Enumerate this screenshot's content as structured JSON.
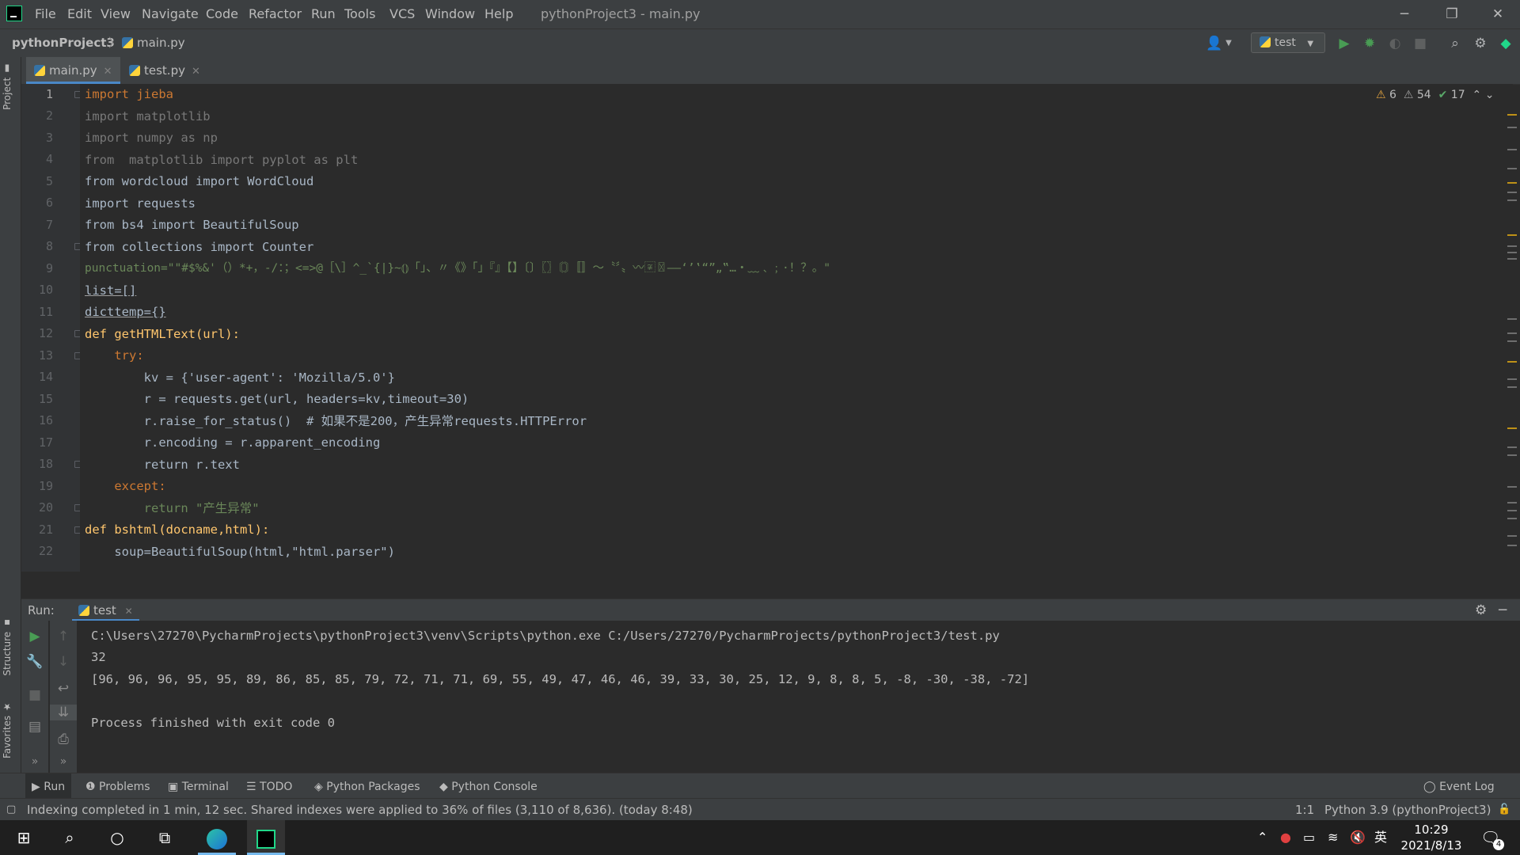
{
  "window": {
    "title": "pythonProject3 - main.py",
    "menu": [
      "File",
      "Edit",
      "View",
      "Navigate",
      "Code",
      "Refactor",
      "Run",
      "Tools",
      "VCS",
      "Window",
      "Help"
    ],
    "controls": {
      "minimize": "─",
      "restore": "❐",
      "close": "✕"
    }
  },
  "navbar": {
    "project": "pythonProject3",
    "file": "main.py",
    "run_config": "test"
  },
  "sidebar": {
    "project_label": "Project",
    "structure_label": "Structure",
    "favorites_label": "Favorites"
  },
  "tabs": [
    {
      "label": "main.py",
      "active": true
    },
    {
      "label": "test.py",
      "active": false
    }
  ],
  "inspections": {
    "errors": "6",
    "warnings": "54",
    "ok": "17"
  },
  "editor": {
    "line_numbers": [
      "1",
      "2",
      "3",
      "4",
      "5",
      "6",
      "7",
      "8",
      "9",
      "10",
      "11",
      "12",
      "13",
      "14",
      "15",
      "16",
      "17",
      "18",
      "19",
      "20",
      "21",
      "22"
    ],
    "lines": [
      "import jieba",
      "import matplotlib",
      "import numpy as np",
      "from  matplotlib import pyplot as plt",
      "from wordcloud import WordCloud",
      "import requests",
      "from bs4 import BeautifulSoup",
      "from collections import Counter",
      "punctuation=\"\"#$%&'（）*+，-/：；<=>@［\\］^_`{|}~⦅⦆「」、〃《》「」『』【】〔〕〖〗〘〙〚〛〜〝〞〟〰〾〿–—‘’‛“”„‟…‧﹏﹑﹔·！？。\"",
      "list=[]",
      "dicttemp={}",
      "def getHTMLText(url):",
      "    try:",
      "        kv = {'user-agent': 'Mozilla/5.0'}",
      "        r = requests.get(url, headers=kv,timeout=30)",
      "        r.raise_for_status()  # 如果不是200，产生异常requests.HTTPError",
      "        r.encoding = r.apparent_encoding",
      "        return r.text",
      "    except:",
      "        return \"产生异常\"",
      "def bshtml(docname,html):",
      "    soup=BeautifulSoup(html,\"html.parser\")"
    ]
  },
  "run": {
    "label": "Run:",
    "tab": "test",
    "output": [
      "C:\\Users\\27270\\PycharmProjects\\pythonProject3\\venv\\Scripts\\python.exe C:/Users/27270/PycharmProjects/pythonProject3/test.py",
      "32",
      "[96, 96, 96, 95, 95, 89, 86, 85, 85, 79, 72, 71, 71, 69, 55, 49, 47, 46, 46, 39, 33, 30, 25, 12, 9, 8, 8, 5, -8, -30, -38, -72]",
      "",
      "Process finished with exit code 0"
    ]
  },
  "tool_windows": [
    "Run",
    "Problems",
    "Terminal",
    "TODO",
    "Python Packages",
    "Python Console"
  ],
  "event_log": "Event Log",
  "status": {
    "message": "Indexing completed in 1 min, 12 sec. Shared indexes were applied to 36% of files (3,110 of 8,636). (today 8:48)",
    "position": "1:1",
    "interpreter": "Python 3.9 (pythonProject3)"
  },
  "taskbar": {
    "time": "10:29",
    "date": "2021/8/13",
    "ime": "英",
    "notifications": "4"
  }
}
